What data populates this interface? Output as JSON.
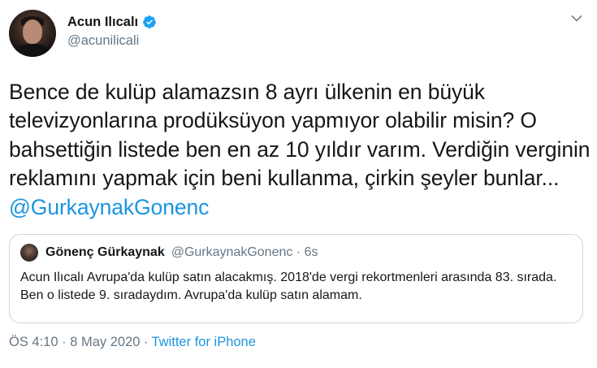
{
  "author": {
    "display_name": "Acun Ilıcalı",
    "handle": "@acunilicali",
    "verified_icon": "verified-badge-icon"
  },
  "tweet": {
    "text": "Bence de kulüp alamazsın 8 ayrı ülkenin en büyük televizyonlarına prodüksüyon yapmıyor olabilir misin? O bahsettiğin listede ben en az 10 yıldır varım. Verdiğin verginin reklamını yapmak için beni kullanma, çirkin şeyler bunlar... ",
    "mention": "@GurkaynakGonenc"
  },
  "quoted": {
    "display_name": "Gönenç Gürkaynak",
    "handle_time": "@GurkaynakGonenc · 6s",
    "text": "Acun Ilıcalı Avrupa'da kulüp satın alacakmış. 2018'de vergi rekortmenleri arasında 83. sırada. Ben o listede 9. sıradaydım. Avrupa'da kulüp satın alamam."
  },
  "meta": {
    "timestamp": "ÖS 4:10 · 8 May 2020 · ",
    "source": "Twitter for iPhone"
  },
  "colors": {
    "link": "#1b95e0",
    "secondary_text": "#657786",
    "border": "#ccd6dd",
    "verified": "#1da1f2"
  }
}
